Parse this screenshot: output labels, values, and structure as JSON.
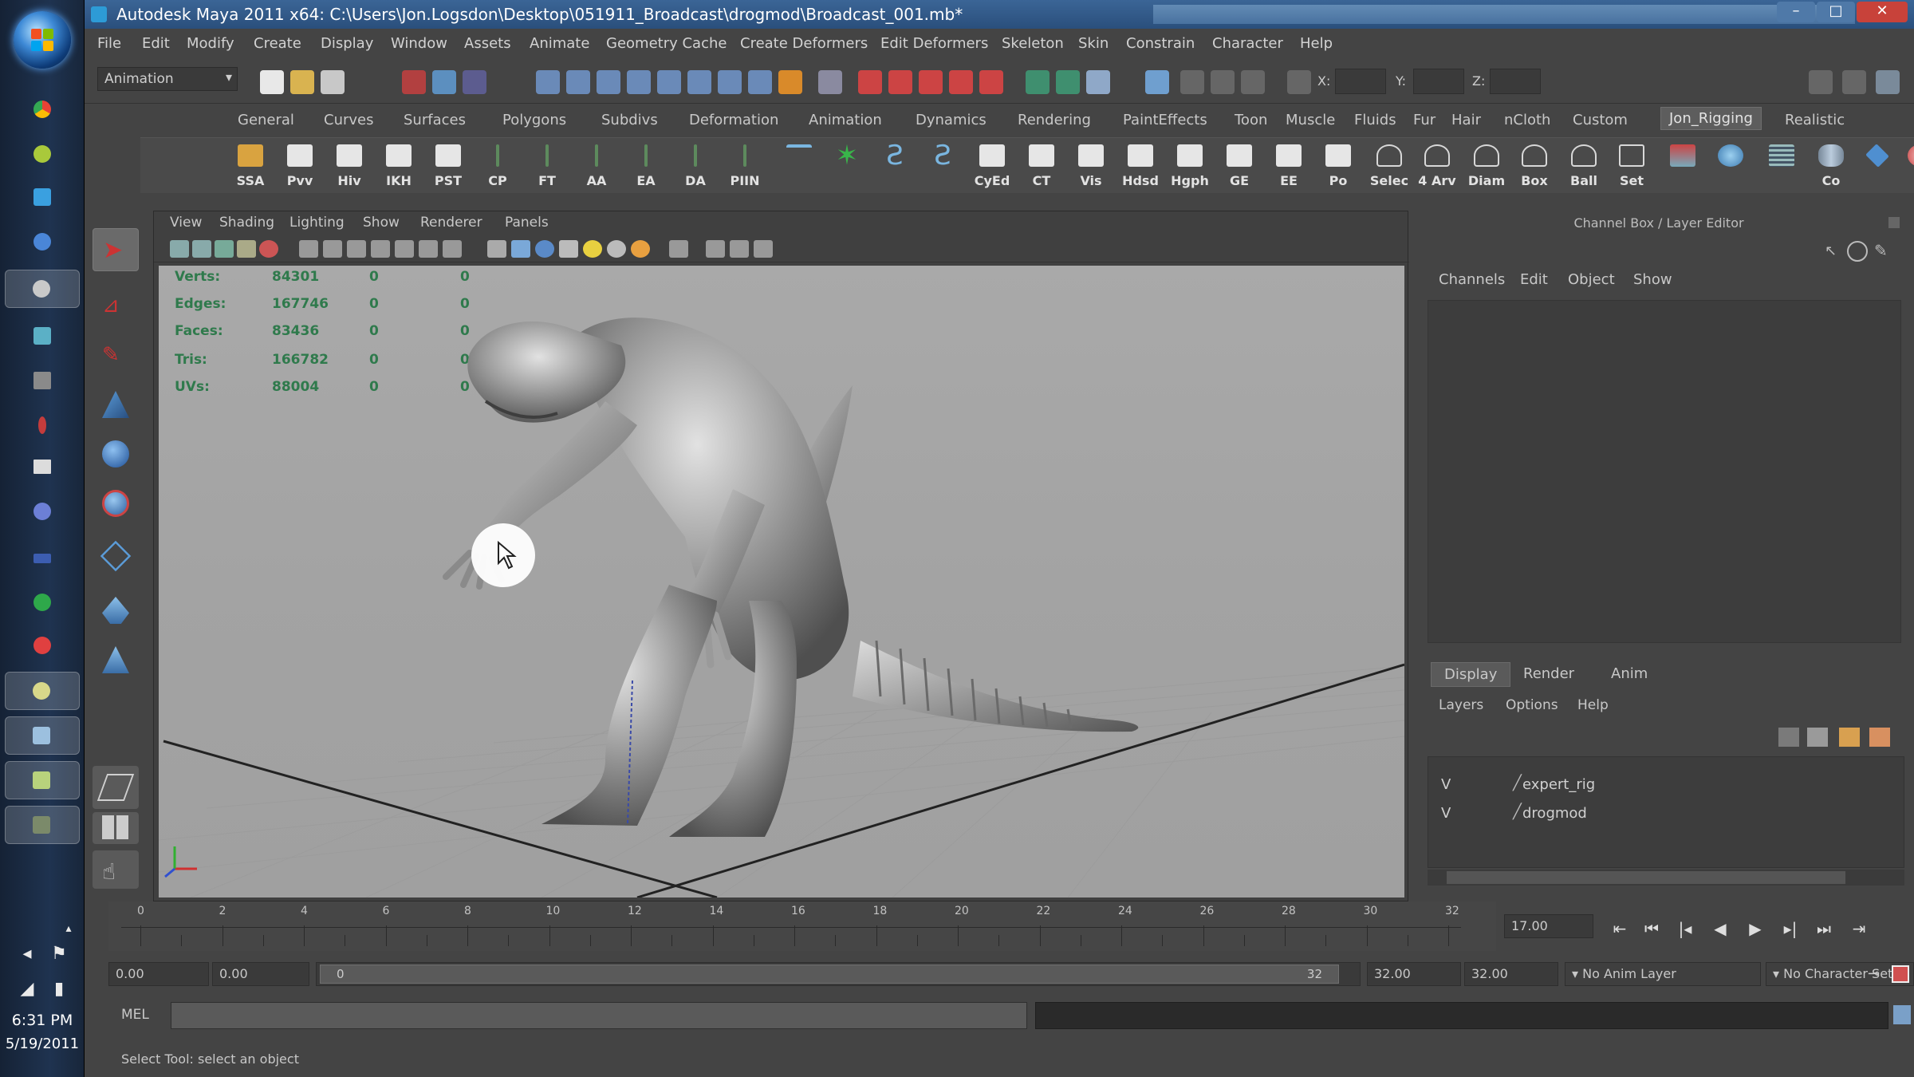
{
  "window": {
    "title": "Autodesk Maya 2011 x64: C:\\Users\\Jon.Logsdon\\Desktop\\051911_Broadcast\\drogmod\\Broadcast_001.mb*"
  },
  "menubar": [
    "File",
    "Edit",
    "Modify",
    "Create",
    "Display",
    "Window",
    "Assets",
    "Animate",
    "Geometry Cache",
    "Create Deformers",
    "Edit Deformers",
    "Skeleton",
    "Skin",
    "Constrain",
    "Character",
    "Help"
  ],
  "status_line": {
    "mode": "Animation",
    "x_label": "X:",
    "y_label": "Y:",
    "z_label": "Z:"
  },
  "shelf_tabs": [
    "General",
    "Curves",
    "Surfaces",
    "Polygons",
    "Subdivs",
    "Deformation",
    "Animation",
    "Dynamics",
    "Rendering",
    "PaintEffects",
    "Toon",
    "Muscle",
    "Fluids",
    "Fur",
    "Hair",
    "nCloth",
    "Custom",
    "Jon_Rigging",
    "Realistic"
  ],
  "shelf_tab_active": "Jon_Rigging",
  "shelf_buttons": [
    "SSA",
    "Pvv",
    "Hiv",
    "IKH",
    "PST",
    "CP",
    "FT",
    "AA",
    "EA",
    "DA",
    "PIIN",
    "",
    "",
    "",
    "",
    "CyEd",
    "CT",
    "Vis",
    "Hdsd",
    "Hgph",
    "GE",
    "EE",
    "Po",
    "Selec",
    "4 Arv",
    "Diam",
    "Box",
    "Ball",
    "Set",
    "",
    "",
    "",
    "",
    "Co",
    ""
  ],
  "panel_menu": [
    "View",
    "Shading",
    "Lighting",
    "Show",
    "Renderer",
    "Panels"
  ],
  "hud": {
    "rows": [
      {
        "label": "Verts:",
        "value": "84301",
        "a": "0",
        "b": "0"
      },
      {
        "label": "Edges:",
        "value": "167746",
        "a": "0",
        "b": "0"
      },
      {
        "label": "Faces:",
        "value": "83436",
        "a": "0",
        "b": "0"
      },
      {
        "label": "Tris:",
        "value": "166782",
        "a": "0",
        "b": "0"
      },
      {
        "label": "UVs:",
        "value": "88004",
        "a": "0",
        "b": "0"
      }
    ]
  },
  "channel_box": {
    "title": "Channel Box / Layer Editor",
    "menus": [
      "Channels",
      "Edit",
      "Object",
      "Show"
    ]
  },
  "layer_editor": {
    "tabs": [
      "Display",
      "Render",
      "Anim"
    ],
    "menus": [
      "Layers",
      "Options",
      "Help"
    ],
    "layers": [
      {
        "visible": "V",
        "name": "expert_rig"
      },
      {
        "visible": "V",
        "name": "drogmod"
      }
    ]
  },
  "time_slider": {
    "ticks": [
      "0",
      "2",
      "4",
      "6",
      "8",
      "10",
      "12",
      "14",
      "16",
      "18",
      "20",
      "22",
      "24",
      "26",
      "28",
      "30",
      "32"
    ],
    "current_frame": "17.00"
  },
  "range_slider": {
    "start_time": "0.00",
    "playback_start": "0.00",
    "handle_start": "0",
    "handle_end": "32",
    "playback_end": "32.00",
    "end_time": "32.00",
    "anim_layer": "No Anim Layer",
    "character_set": "No Character Set"
  },
  "command_line": {
    "label": "MEL"
  },
  "help_line": {
    "text": "Select Tool: select an object"
  },
  "taskbar": {
    "time": "6:31 PM",
    "date": "5/19/2011"
  },
  "colors": {
    "maya_bg": "#444444",
    "viewport_bg": "#a6a6a6",
    "hud_text": "#2f7a4c",
    "title_bar": "#2a4f7c"
  }
}
